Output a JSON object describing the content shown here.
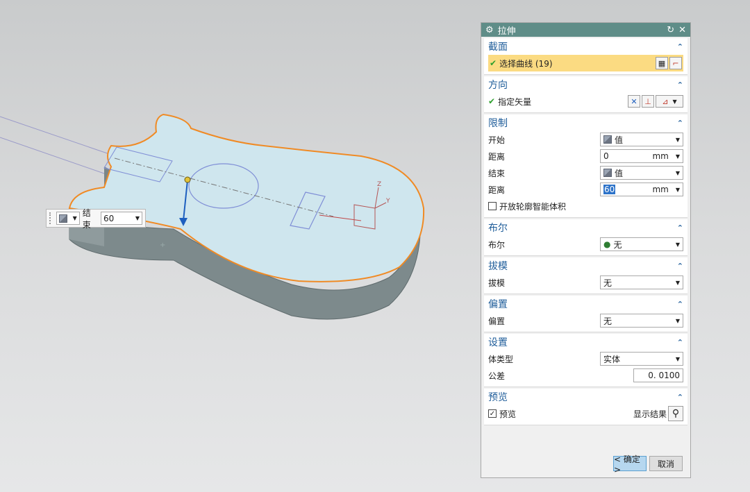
{
  "float_input": {
    "label": "结束",
    "value": "60"
  },
  "dialog": {
    "title": "拉伸",
    "sections": {
      "section": {
        "header": "截面",
        "select_curve": "选择曲线 (19)"
      },
      "direction": {
        "header": "方向",
        "vector": "指定矢量"
      },
      "limits": {
        "header": "限制",
        "start_label": "开始",
        "start_value": "值",
        "start_dist_label": "距离",
        "start_dist_value": "0",
        "start_dist_unit": "mm",
        "end_label": "结束",
        "end_value": "值",
        "end_dist_label": "距离",
        "end_dist_value": "60",
        "end_dist_unit": "mm",
        "open_profile": "开放轮廓智能体积"
      },
      "boolean": {
        "header": "布尔",
        "label": "布尔",
        "value": "无"
      },
      "draft": {
        "header": "拔模",
        "label": "拔模",
        "value": "无"
      },
      "offset": {
        "header": "偏置",
        "label": "偏置",
        "value": "无"
      },
      "settings": {
        "header": "设置",
        "body_type_label": "体类型",
        "body_type_value": "实体",
        "tolerance_label": "公差",
        "tolerance_value": "0. 0100"
      },
      "preview": {
        "header": "预览",
        "checkbox_label": "预览",
        "show_result": "显示结果"
      }
    },
    "ok_button": "< 确定 >",
    "cancel_button": "取消"
  }
}
